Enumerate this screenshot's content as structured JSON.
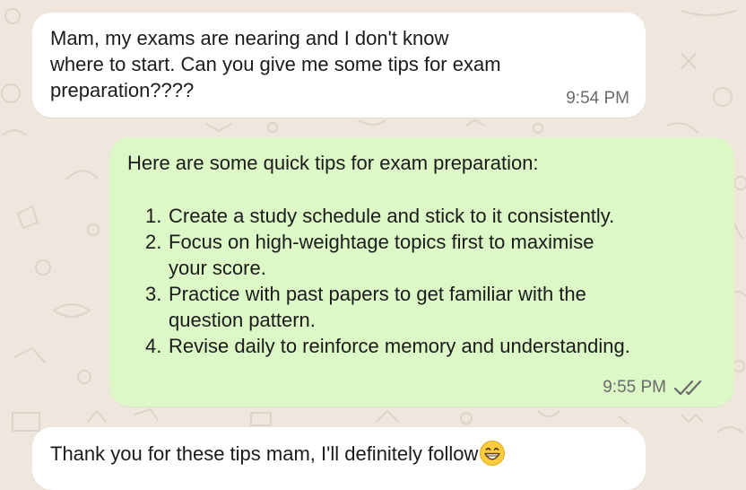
{
  "messages": [
    {
      "direction": "incoming",
      "text_lines": [
        "Mam, my exams are nearing and I don't know",
        "where to start. Can you give me some tips for exam",
        "preparation????"
      ],
      "time": "9:54 PM"
    },
    {
      "direction": "outgoing",
      "intro": "Here are some quick tips for exam preparation:",
      "tips": [
        {
          "num": "1.",
          "lines": [
            "Create a study schedule and stick to it consistently."
          ]
        },
        {
          "num": "2.",
          "lines": [
            "Focus on high-weightage topics first to maximise",
            "your score."
          ]
        },
        {
          "num": "3.",
          "lines": [
            "Practice with past papers to get familiar with the",
            "question pattern."
          ]
        },
        {
          "num": "4.",
          "lines": [
            "Revise daily to reinforce memory and understanding."
          ]
        }
      ],
      "time": "9:55 PM",
      "status_icon": "double-check-icon"
    },
    {
      "direction": "incoming",
      "text": "Thank you for these tips mam, I'll definitely follow",
      "emoji": "grinning-face-emoji"
    }
  ],
  "colors": {
    "wallpaper": "#efe7de",
    "incoming_bubble": "#ffffff",
    "outgoing_bubble": "#dcf8c6",
    "text": "#1b1b1b",
    "timestamp": "#6b6b6b",
    "read_check": "#6b6b6b"
  }
}
